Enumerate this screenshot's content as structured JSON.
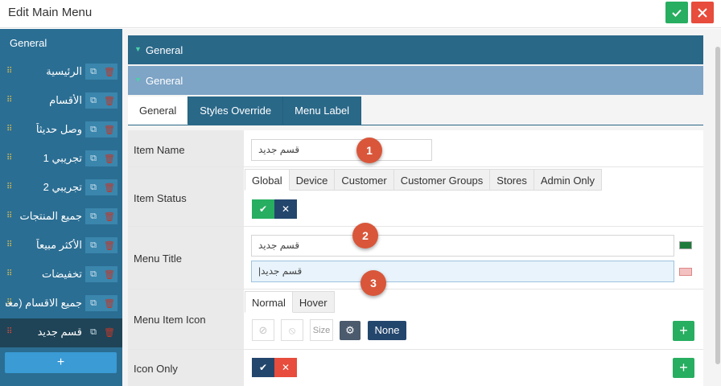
{
  "window": {
    "title": "Edit Main Menu"
  },
  "sidebar": {
    "heading": "General",
    "items": [
      {
        "label": "الرئيسية"
      },
      {
        "label": "الأقسام"
      },
      {
        "label": "وصل حديثاً"
      },
      {
        "label": "تجريبي 1"
      },
      {
        "label": "تجريبي 2"
      },
      {
        "label": "جميع المنتجات"
      },
      {
        "label": "الأكثر مبيعاً"
      },
      {
        "label": "تخفيضات"
      },
      {
        "label": "جميع الاقسام (معطلة)"
      },
      {
        "label": "قسم جديد"
      }
    ],
    "add_label": "+"
  },
  "sections": {
    "first": "General",
    "second": "General"
  },
  "tabs": [
    "General",
    "Styles Override",
    "Menu Label"
  ],
  "form": {
    "item_name": {
      "label": "Item Name",
      "value": "قسم جديد"
    },
    "item_status": {
      "label": "Item Status",
      "tabs": [
        "Global",
        "Device",
        "Customer",
        "Customer Groups",
        "Stores",
        "Admin Only"
      ]
    },
    "menu_title": {
      "label": "Menu Title",
      "value_ar": "قسم جديد",
      "value_en": "قسم جديد|"
    },
    "menu_item_icon": {
      "label": "Menu Item Icon",
      "tabs": [
        "Normal",
        "Hover"
      ],
      "size_placeholder": "Size",
      "none_label": "None"
    },
    "icon_only": {
      "label": "Icon Only"
    }
  },
  "badges": [
    "1",
    "2",
    "3"
  ],
  "colors": {
    "sidebar": "#2b6e93",
    "section": "#2a6888",
    "success": "#27ae60",
    "danger": "#e74c3c",
    "navy": "#23466d",
    "badge": "#d9563a"
  }
}
